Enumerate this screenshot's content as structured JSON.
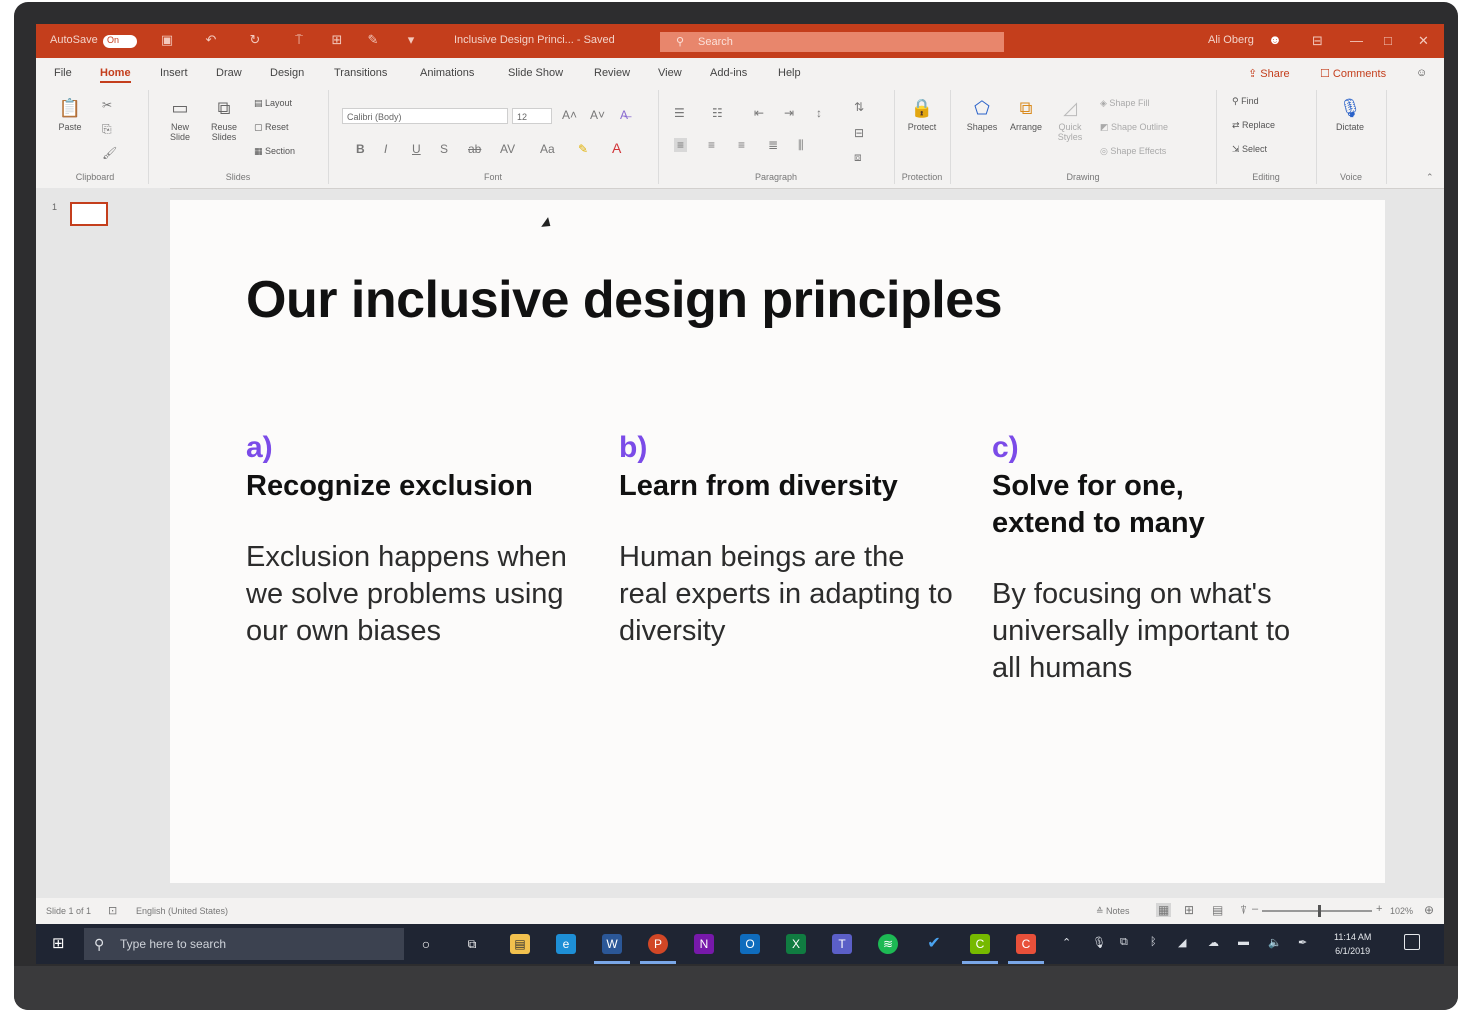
{
  "titlebar": {
    "autosave_label": "AutoSave",
    "autosave_state": "On",
    "document_title": "Inclusive Design Princi... - Saved",
    "search_placeholder": "Search",
    "user_name": "Ali Oberg"
  },
  "ribbon_tabs": [
    "File",
    "Home",
    "Insert",
    "Draw",
    "Design",
    "Transitions",
    "Animations",
    "Slide Show",
    "Review",
    "View",
    "Add-ins",
    "Help"
  ],
  "ribbon_right": {
    "share": "Share",
    "comments": "Comments"
  },
  "ribbon": {
    "paste": "Paste",
    "new_slide": "New\nSlide",
    "reuse_slides": "Reuse\nSlides",
    "layout": "Layout",
    "reset": "Reset",
    "section": "Section",
    "font_name": "Calibri (Body)",
    "font_size": "12",
    "protect": "Protect",
    "shapes": "Shapes",
    "arrange": "Arrange",
    "quick_styles": "Quick\nStyles",
    "shape_fill": "Shape Fill",
    "shape_outline": "Shape Outline",
    "shape_effects": "Shape Effects",
    "find": "Find",
    "replace": "Replace",
    "select": "Select",
    "dictate": "Dictate",
    "groups": {
      "clipboard": "Clipboard",
      "slides": "Slides",
      "font": "Font",
      "paragraph": "Paragraph",
      "protection": "Protection",
      "drawing": "Drawing",
      "editing": "Editing",
      "voice": "Voice"
    }
  },
  "thumbnail": {
    "number": "1"
  },
  "slide": {
    "title": "Our inclusive design principles",
    "columns": [
      {
        "letter": "a)",
        "heading": "Recognize exclusion",
        "body": "Exclusion happens when we solve problems using our own biases"
      },
      {
        "letter": "b)",
        "heading": "Learn from diversity",
        "body": "Human beings are the real experts in adapting to diversity"
      },
      {
        "letter": "c)",
        "heading": "Solve for one, extend to many",
        "body": "By focusing on what's universally important to all humans"
      }
    ]
  },
  "statusbar": {
    "slide_counter": "Slide 1 of 1",
    "language": "English (United States)",
    "notes": "Notes",
    "zoom": "102%"
  },
  "taskbar": {
    "search_placeholder": "Type here to search",
    "time": "11:14 AM",
    "date": "6/1/2019"
  },
  "colors": {
    "accent": "#c43e1c",
    "letter_purple": "#7b4be8",
    "taskbar": "#1f2533"
  }
}
